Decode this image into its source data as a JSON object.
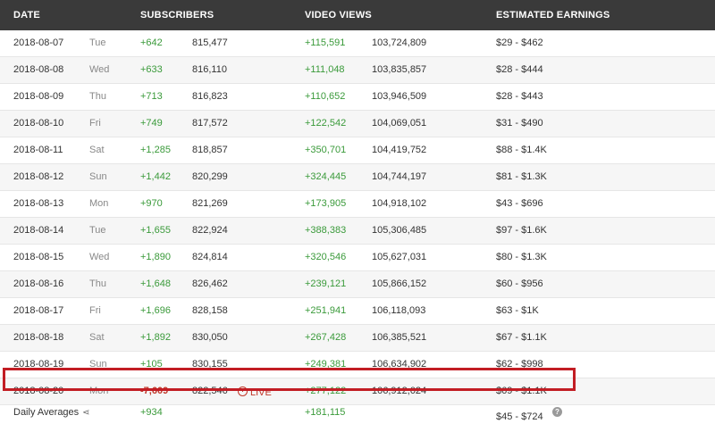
{
  "header": {
    "date": "DATE",
    "subscribers": "SUBSCRIBERS",
    "video_views": "VIDEO VIEWS",
    "earnings": "ESTIMATED EARNINGS"
  },
  "rows": [
    {
      "date": "2018-08-07",
      "day": "Tue",
      "sub_change": "+642",
      "sub_total": "815,477",
      "views_change": "+115,591",
      "views_total": "103,724,809",
      "earnings": "$29  -  $462"
    },
    {
      "date": "2018-08-08",
      "day": "Wed",
      "sub_change": "+633",
      "sub_total": "816,110",
      "views_change": "+111,048",
      "views_total": "103,835,857",
      "earnings": "$28  -  $444"
    },
    {
      "date": "2018-08-09",
      "day": "Thu",
      "sub_change": "+713",
      "sub_total": "816,823",
      "views_change": "+110,652",
      "views_total": "103,946,509",
      "earnings": "$28  -  $443"
    },
    {
      "date": "2018-08-10",
      "day": "Fri",
      "sub_change": "+749",
      "sub_total": "817,572",
      "views_change": "+122,542",
      "views_total": "104,069,051",
      "earnings": "$31  -  $490"
    },
    {
      "date": "2018-08-11",
      "day": "Sat",
      "sub_change": "+1,285",
      "sub_total": "818,857",
      "views_change": "+350,701",
      "views_total": "104,419,752",
      "earnings": "$88  -  $1.4K"
    },
    {
      "date": "2018-08-12",
      "day": "Sun",
      "sub_change": "+1,442",
      "sub_total": "820,299",
      "views_change": "+324,445",
      "views_total": "104,744,197",
      "earnings": "$81  -  $1.3K"
    },
    {
      "date": "2018-08-13",
      "day": "Mon",
      "sub_change": "+970",
      "sub_total": "821,269",
      "views_change": "+173,905",
      "views_total": "104,918,102",
      "earnings": "$43  -  $696"
    },
    {
      "date": "2018-08-14",
      "day": "Tue",
      "sub_change": "+1,655",
      "sub_total": "822,924",
      "views_change": "+388,383",
      "views_total": "105,306,485",
      "earnings": "$97  -  $1.6K"
    },
    {
      "date": "2018-08-15",
      "day": "Wed",
      "sub_change": "+1,890",
      "sub_total": "824,814",
      "views_change": "+320,546",
      "views_total": "105,627,031",
      "earnings": "$80  -  $1.3K"
    },
    {
      "date": "2018-08-16",
      "day": "Thu",
      "sub_change": "+1,648",
      "sub_total": "826,462",
      "views_change": "+239,121",
      "views_total": "105,866,152",
      "earnings": "$60  -  $956"
    },
    {
      "date": "2018-08-17",
      "day": "Fri",
      "sub_change": "+1,696",
      "sub_total": "828,158",
      "views_change": "+251,941",
      "views_total": "106,118,093",
      "earnings": "$63  -  $1K"
    },
    {
      "date": "2018-08-18",
      "day": "Sat",
      "sub_change": "+1,892",
      "sub_total": "830,050",
      "views_change": "+267,428",
      "views_total": "106,385,521",
      "earnings": "$67  -  $1.1K"
    },
    {
      "date": "2018-08-19",
      "day": "Sun",
      "sub_change": "+105",
      "sub_total": "830,155",
      "views_change": "+249,381",
      "views_total": "106,634,902",
      "earnings": "$62  -  $998"
    },
    {
      "date": "2018-08-20",
      "day": "Mon",
      "sub_change": "-7,609",
      "sub_total": "822,546",
      "views_change": "+277,122",
      "views_total": "106,912,024",
      "earnings": "$69  -  $1.1K",
      "live": "LIVE"
    }
  ],
  "averages": {
    "label": "Daily Averages",
    "share_icon": "share-icon",
    "sub_change": "+934",
    "views_change": "+181,115",
    "earnings": "$45  -  $724",
    "help_icon": "?"
  },
  "colors": {
    "header_bg": "#3a3a3a",
    "positive": "#3a9a3a",
    "negative": "#c0392b",
    "highlight_border": "#c21d24"
  }
}
